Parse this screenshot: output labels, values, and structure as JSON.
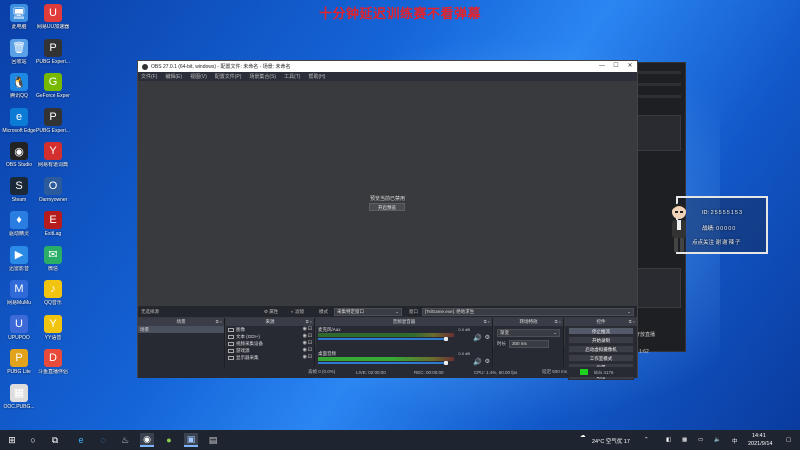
{
  "banner": "十分钟延迟训练赛不看弹幕",
  "desktop_icons": [
    {
      "label": "此电脑",
      "glyph": "🖥",
      "color": "#3d8fe0"
    },
    {
      "label": "网易UU加速器",
      "glyph": "U",
      "color": "#e23b3b"
    },
    {
      "label": "回收站",
      "glyph": "🗑",
      "color": "#5aa0e6"
    },
    {
      "label": "PUBG Experi...",
      "glyph": "P",
      "color": "#333333"
    },
    {
      "label": "腾讯QQ",
      "glyph": "🐧",
      "color": "#1e88e5"
    },
    {
      "label": "GeForce Experience",
      "glyph": "G",
      "color": "#76b900"
    },
    {
      "label": "Microsoft Edge",
      "glyph": "e",
      "color": "#0c7bd6"
    },
    {
      "label": "PUBG Experi...",
      "glyph": "P",
      "color": "#333333"
    },
    {
      "label": "OBS Studio",
      "glyph": "◉",
      "color": "#222222"
    },
    {
      "label": "网易有道词典",
      "glyph": "Y",
      "color": "#d32f2f"
    },
    {
      "label": "Steam",
      "glyph": "S",
      "color": "#1b2838"
    },
    {
      "label": "Oarmyowner",
      "glyph": "O",
      "color": "#2c5a9a"
    },
    {
      "label": "驱动精灵",
      "glyph": "♦",
      "color": "#2a7de1"
    },
    {
      "label": "ExitLag",
      "glyph": "E",
      "color": "#b71c1c"
    },
    {
      "label": "迅雷影音",
      "glyph": "▶",
      "color": "#2a8ae6"
    },
    {
      "label": "微信",
      "glyph": "✉",
      "color": "#2aae67"
    },
    {
      "label": "网易MuMu",
      "glyph": "M",
      "color": "#2f6ad8"
    },
    {
      "label": "QQ音乐",
      "glyph": "♪",
      "color": "#f1c40f"
    },
    {
      "label": "UPUPOO",
      "glyph": "U",
      "color": "#3d6ad8"
    },
    {
      "label": "YY语音",
      "glyph": "Y",
      "color": "#f1c40f"
    },
    {
      "label": "PUBG Lite",
      "glyph": "P",
      "color": "#e1a21c"
    },
    {
      "label": "斗鱼直播伴侣",
      "glyph": "D",
      "color": "#e84a3c"
    },
    {
      "label": "OOC.PUBG...",
      "glyph": "▦",
      "color": "#dddddd"
    }
  ],
  "obs": {
    "title": "OBS 27.0.1 (64-bit, windows) - 配置文件: 未命名 - 场景: 未命名",
    "menu": [
      "文件(F)",
      "编辑(E)",
      "视图(V)",
      "配置文件(P)",
      "场景集合(S)",
      "工具(T)",
      "帮助(H)"
    ],
    "preview_message": "预览当前已禁用",
    "preview_enable_button": "开启预览",
    "context_bar": {
      "no_source": "无选择源",
      "properties": "属性",
      "filters": "滤镜",
      "mode_label": "模式",
      "mode_value": "采集特定窗口",
      "window_label": "窗口",
      "window_value": "[TslGame.exe]: 绝地求生"
    },
    "docks": {
      "scenes": {
        "title": "场景",
        "items": [
          "场景"
        ]
      },
      "sources": {
        "title": "来源",
        "items": [
          "图像",
          "文本 (GDI+)",
          "视频采集设备",
          "游戏源",
          "显示器采集"
        ]
      },
      "mixer": {
        "title": "音频混音器",
        "tracks": [
          {
            "name": "麦克风/Aux",
            "db": "0.0 dB"
          },
          {
            "name": "桌面音频",
            "db": "0.0 dB"
          }
        ]
      },
      "transitions": {
        "title": "转场特效",
        "type": "渐变",
        "duration_label": "时长",
        "duration_value": "300 ms"
      },
      "controls": {
        "title": "控件",
        "buttons": [
          "停止推流",
          "开始录制",
          "启动虚拟摄像机",
          "工作室模式",
          "设置",
          "退出"
        ]
      }
    },
    "status": {
      "dropped": "丢帧 0 (0.0%)",
      "live": "LIVE: 02:00:00",
      "rec": "REC: 00:00:00",
      "cpu": "CPU: 1.4%, 60.00 fps",
      "kbps": "延迟 500 ms",
      "bitrate": "kb/s 4176"
    }
  },
  "popup": {
    "rows": [
      {
        "key": "ID:",
        "value": "25555153"
      },
      {
        "key": "战绩:",
        "value": "00000"
      },
      {
        "key": "点点关注",
        "value": "谢谢辣子"
      }
    ]
  },
  "bgwin": {
    "label": "开放直播",
    "stat": "1:62"
  },
  "taskbar": {
    "weather": "24°C 空气优 17",
    "time": "14:41",
    "date": "2021/9/14"
  }
}
